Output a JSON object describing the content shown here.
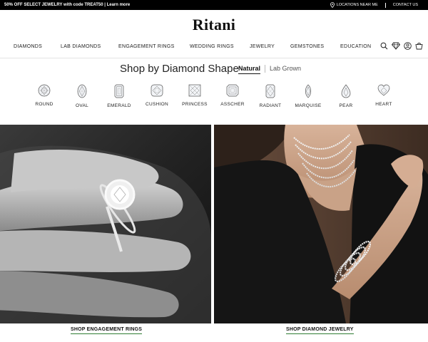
{
  "promo": {
    "message": "50% OFF SELECT JEWELRY with code TREAT50 | Learn more",
    "locations": "LOCATIONS NEAR ME",
    "contact": "CONTACT US"
  },
  "brand": {
    "logo": "Ritani"
  },
  "nav": {
    "items": [
      {
        "label": "DIAMONDS"
      },
      {
        "label": "LAB DIAMONDS"
      },
      {
        "label": "ENGAGEMENT RINGS"
      },
      {
        "label": "WEDDING RINGS"
      },
      {
        "label": "JEWELRY"
      },
      {
        "label": "GEMSTONES"
      },
      {
        "label": "EDUCATION"
      }
    ],
    "icons": [
      "search-icon",
      "diamond-icon",
      "account-icon",
      "cart-icon"
    ]
  },
  "shape_section": {
    "title": "Shop by Diamond Shape",
    "tabs": [
      {
        "label": "Natural",
        "active": true
      },
      {
        "label": "Lab Grown",
        "active": false
      }
    ],
    "shapes": [
      {
        "label": "ROUND",
        "icon": "round-diamond-icon"
      },
      {
        "label": "OVAL",
        "icon": "oval-diamond-icon"
      },
      {
        "label": "EMERALD",
        "icon": "emerald-diamond-icon"
      },
      {
        "label": "CUSHION",
        "icon": "cushion-diamond-icon"
      },
      {
        "label": "PRINCESS",
        "icon": "princess-diamond-icon"
      },
      {
        "label": "ASSCHER",
        "icon": "asscher-diamond-icon"
      },
      {
        "label": "RADIANT",
        "icon": "radiant-diamond-icon"
      },
      {
        "label": "MARQUISE",
        "icon": "marquise-diamond-icon"
      },
      {
        "label": "PEAR",
        "icon": "pear-diamond-icon"
      },
      {
        "label": "HEART",
        "icon": "heart-diamond-icon"
      }
    ]
  },
  "features": [
    {
      "cta": "SHOP ENGAGEMENT RINGS",
      "image": "engagement-ring-hand-photo"
    },
    {
      "cta": "SHOP DIAMOND JEWELRY",
      "image": "diamond-necklaces-bracelets-photo"
    }
  ],
  "colors": {
    "promo_bg": "#000000",
    "accent_underline": "#2e7d32",
    "text": "#1a1a1a"
  }
}
